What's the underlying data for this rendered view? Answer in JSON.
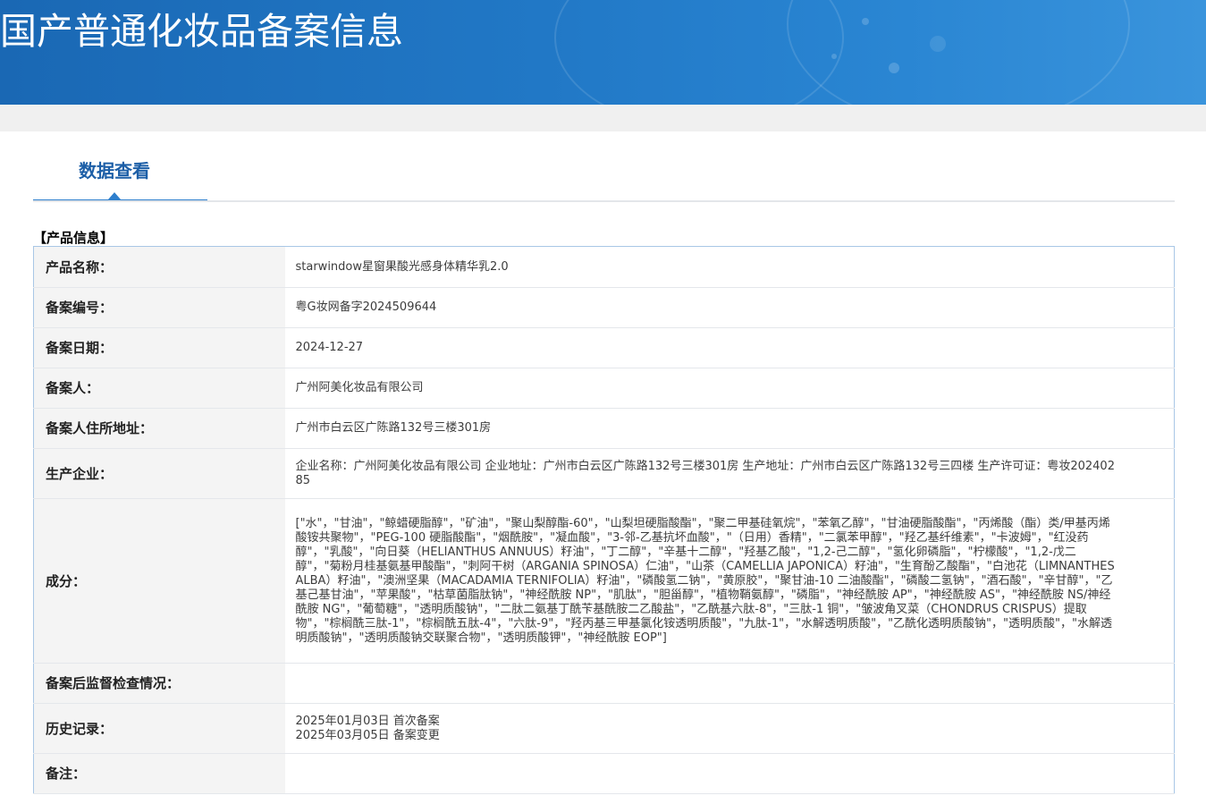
{
  "header": {
    "title": "国产普通化妆品备案信息"
  },
  "tab": {
    "label": "数据查看"
  },
  "section": {
    "title": "【产品信息】"
  },
  "product": {
    "name_label": "产品名称：",
    "name_value": "starwindow星窗果酸光感身体精华乳2.0",
    "record_no_label": "备案编号：",
    "record_no_value": "粤G妆网备字2024509644",
    "record_date_label": "备案日期：",
    "record_date_value": "2024-12-27",
    "registrant_label": "备案人：",
    "registrant_value": "广州阿美化妆品有限公司",
    "registrant_address_label": "备案人住所地址：",
    "registrant_address_value": "广州市白云区广陈路132号三楼301房",
    "manufacturer_label": "生产企业：",
    "manufacturer_value": "企业名称：广州阿美化妆品有限公司 企业地址：广州市白云区广陈路132号三楼301房 生产地址：广州市白云区广陈路132号三四楼 生产许可证：粤妆20240285",
    "ingredients_label": "成分：",
    "ingredients_value": "[\"水\"，\"甘油\"，\"鲸蜡硬脂醇\"，\"矿油\"，\"聚山梨醇酯-60\"，\"山梨坦硬脂酸酯\"，\"聚二甲基硅氧烷\"，\"苯氧乙醇\"，\"甘油硬脂酸酯\"，\"丙烯酸（酯）类/甲基丙烯酸铵共聚物\"，\"PEG-100 硬脂酸酯\"，\"烟酰胺\"，\"凝血酸\"，\"3-邻-乙基抗坏血酸\"，\"（日用）香精\"，\"二氯苯甲醇\"，\"羟乙基纤维素\"，\"卡波姆\"，\"红没药醇\"，\"乳酸\"，\"向日葵（HELIANTHUS ANNUUS）籽油\"，\"丁二醇\"，\"辛基十二醇\"，\"羟基乙酸\"，\"1,2-己二醇\"，\"氢化卵磷脂\"，\"柠檬酸\"，\"1,2-戊二醇\"，\"菊粉月桂基氨基甲酸酯\"，\"刺阿干树（ARGANIA SPINOSA）仁油\"，\"山茶（CAMELLIA JAPONICA）籽油\"，\"生育酚乙酸酯\"，\"白池花（LIMNANTHES ALBA）籽油\"，\"澳洲坚果（MACADAMIA TERNIFOLIA）籽油\"，\"磷酸氢二钠\"，\"黄原胶\"，\"聚甘油-10 二油酸酯\"，\"磷酸二氢钠\"，\"酒石酸\"，\"辛甘醇\"，\"乙基己基甘油\"，\"苹果酸\"，\"枯草菌脂肽钠\"，\"神经酰胺 NP\"，\"肌肽\"，\"胆甾醇\"，\"植物鞘氨醇\"，\"磷脂\"，\"神经酰胺 AP\"，\"神经酰胺 AS\"，\"神经酰胺 NS/神经酰胺 NG\"，\"葡萄糖\"，\"透明质酸钠\"，\"二肽二氨基丁酰苄基酰胺二乙酸盐\"，\"乙酰基六肽-8\"，\"三肽-1 铜\"，\"皱波角叉菜（CHONDRUS CRISPUS）提取物\"，\"棕榈酰三肽-1\"，\"棕榈酰五肽-4\"，\"六肽-9\"，\"羟丙基三甲基氯化铵透明质酸\"，\"九肽-1\"，\"水解透明质酸\"，\"乙酰化透明质酸钠\"，\"透明质酸\"，\"水解透明质酸钠\"，\"透明质酸钠交联聚合物\"，\"透明质酸钾\"，\"神经酰胺 EOP\"]",
    "inspection_label": "备案后监督检查情况：",
    "inspection_value": "",
    "history_label": "历史记录：",
    "history": [
      "2025年01月03日 首次备案",
      "2025年03月05日 备案变更"
    ],
    "remarks_label": "备注：",
    "remarks_value": ""
  },
  "colors": {
    "banner": "#2178c6",
    "tab_text": "#1d5fa7",
    "tab_underline": "#2e7fcd",
    "table_border": "#a9c7e6",
    "label_bg": "#f4f4f4"
  }
}
